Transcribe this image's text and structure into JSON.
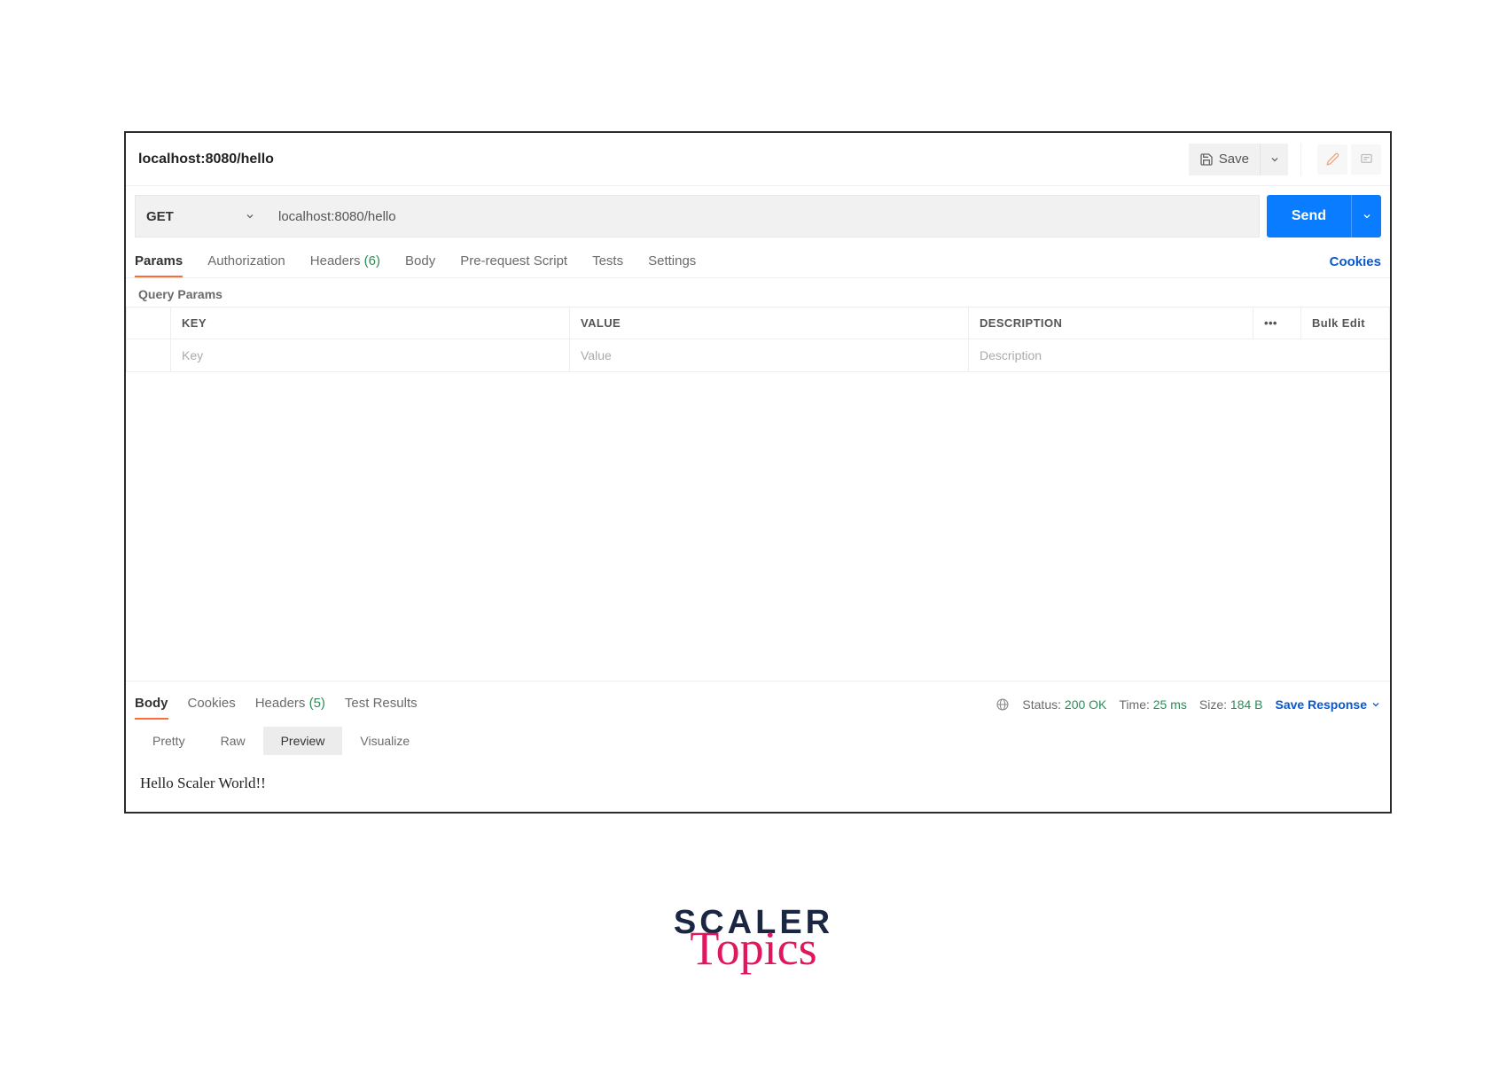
{
  "header": {
    "title": "localhost:8080/hello",
    "save_label": "Save"
  },
  "request": {
    "method": "GET",
    "url": "localhost:8080/hello",
    "send_label": "Send"
  },
  "req_tabs": {
    "params": "Params",
    "authorization": "Authorization",
    "headers_label": "Headers",
    "headers_count": "(6)",
    "body": "Body",
    "prerequest": "Pre-request Script",
    "tests": "Tests",
    "settings": "Settings",
    "cookies": "Cookies"
  },
  "query_params": {
    "section_label": "Query Params",
    "key_header": "KEY",
    "value_header": "VALUE",
    "description_header": "DESCRIPTION",
    "bulk_edit": "Bulk Edit",
    "key_placeholder": "Key",
    "value_placeholder": "Value",
    "description_placeholder": "Description"
  },
  "resp_tabs": {
    "body": "Body",
    "cookies": "Cookies",
    "headers_label": "Headers",
    "headers_count": "(5)",
    "test_results": "Test Results"
  },
  "resp_meta": {
    "status_label": "Status:",
    "status_value": "200 OK",
    "time_label": "Time:",
    "time_value": "25 ms",
    "size_label": "Size:",
    "size_value": "184 B",
    "save_response": "Save Response"
  },
  "views": {
    "pretty": "Pretty",
    "raw": "Raw",
    "preview": "Preview",
    "visualize": "Visualize"
  },
  "response_body": "Hello Scaler World!!",
  "logo": {
    "main": "SCALER",
    "sub": "Topics"
  }
}
